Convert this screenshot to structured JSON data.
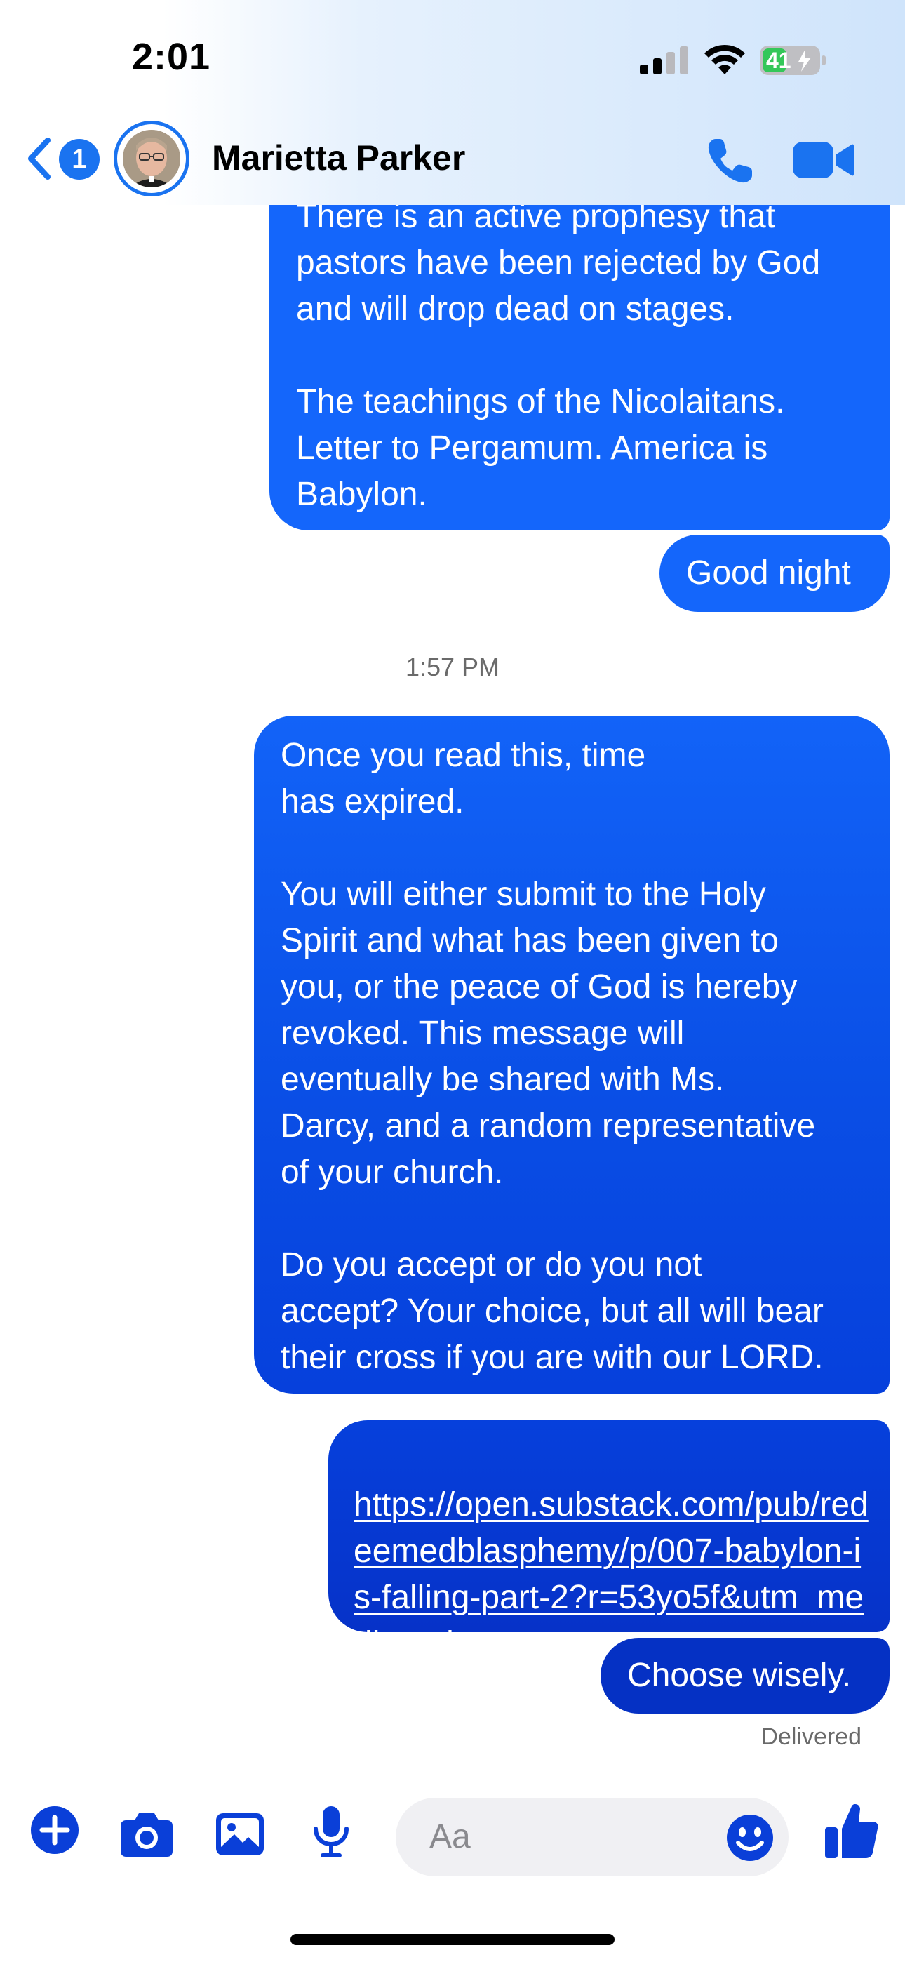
{
  "status_bar": {
    "time": "2:01",
    "battery": "41",
    "icons": [
      "cellular-signal-icon",
      "wifi-icon",
      "battery-charging-icon"
    ]
  },
  "header": {
    "unread_count": "1",
    "contact_name": "Marietta Parker",
    "icons": [
      "back-chevron-icon",
      "phone-icon",
      "video-camera-icon"
    ]
  },
  "messages": [
    {
      "text": "There is an active prophesy that\npastors have been rejected by God\nand will drop dead on stages.\n\nThe teachings of the Nicolaitans.\nLetter to Pergamum. America is\nBabylon."
    },
    {
      "text": "Good night"
    },
    {
      "text": "Once you read this, time\nhas expired.\n\nYou will either submit to the Holy\nSpirit and what has been given to\nyou, or the peace of God is hereby\nrevoked. This message will\neventually be shared with Ms.\nDarcy, and a random representative\nof your church.\n\nDo you accept or do you not\naccept? Your choice, but all will bear\ntheir cross if you are with our LORD."
    },
    {
      "text": "https://open.substack.com/pub/redeemedblasphemy/p/007-babylon-is-falling-part-2?r=53yo5f&utm_medium=ios"
    },
    {
      "text": "Choose wisely."
    }
  ],
  "timestamp": "1:57 PM",
  "delivery_status": "Delivered",
  "composer": {
    "placeholder": "Aa",
    "icons": [
      "plus-icon",
      "camera-icon",
      "image-icon",
      "microphone-icon",
      "emoji-icon",
      "thumbs-up-icon"
    ]
  },
  "colors": {
    "accent": "#1a73f0",
    "bubble_top": "#1466fb",
    "bubble_bottom": "#0531c4"
  }
}
